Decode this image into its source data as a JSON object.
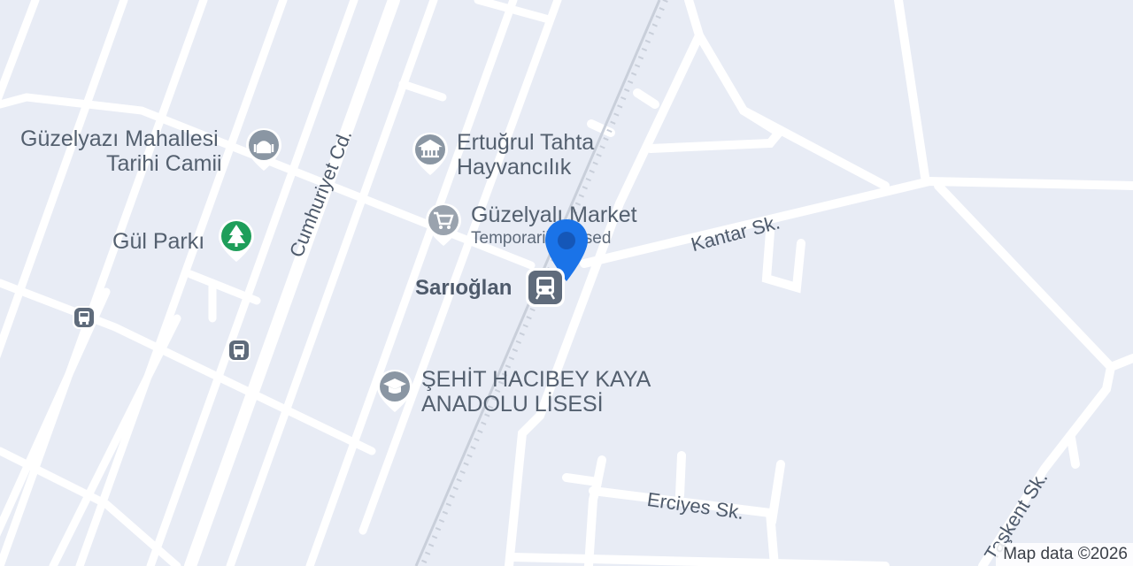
{
  "map": {
    "streets": {
      "cumhuriyet": "Cumhuriyet Cd.",
      "kantar": "Kantar Sk.",
      "erciyes": "Erciyes Sk.",
      "taskent": "Taşkent Sk."
    },
    "pois": {
      "mosque": {
        "name_line1": "Güzelyazı Mahallesi",
        "name_line2": "Tarihi Camii",
        "icon": "mosque-icon",
        "color": "#8a96a3"
      },
      "park": {
        "name": "Gül Parkı",
        "icon": "tree-icon",
        "color": "#1e9e5a"
      },
      "museum": {
        "name_line1": "Ertuğrul Tahta",
        "name_line2": "Hayvancılık",
        "icon": "museum-icon",
        "color": "#8a96a3"
      },
      "market": {
        "name": "Güzelyalı Market",
        "status": "Temporarily closed",
        "icon": "cart-icon",
        "color": "#9aa3ae"
      },
      "school": {
        "name_line1": "ŞEHİT HACIBEY KAYA",
        "name_line2": "ANADOLU LİSESİ",
        "icon": "school-icon",
        "color": "#8a96a3"
      }
    },
    "station": {
      "name": "Sarıoğlan",
      "icon": "train-station-icon"
    },
    "selected_pin": {
      "icon": "location-pin-icon",
      "color": "#1a73e8"
    },
    "bus_stops": [
      "bus-stop-icon",
      "bus-stop-icon"
    ],
    "attribution": "Map data ©2026"
  }
}
